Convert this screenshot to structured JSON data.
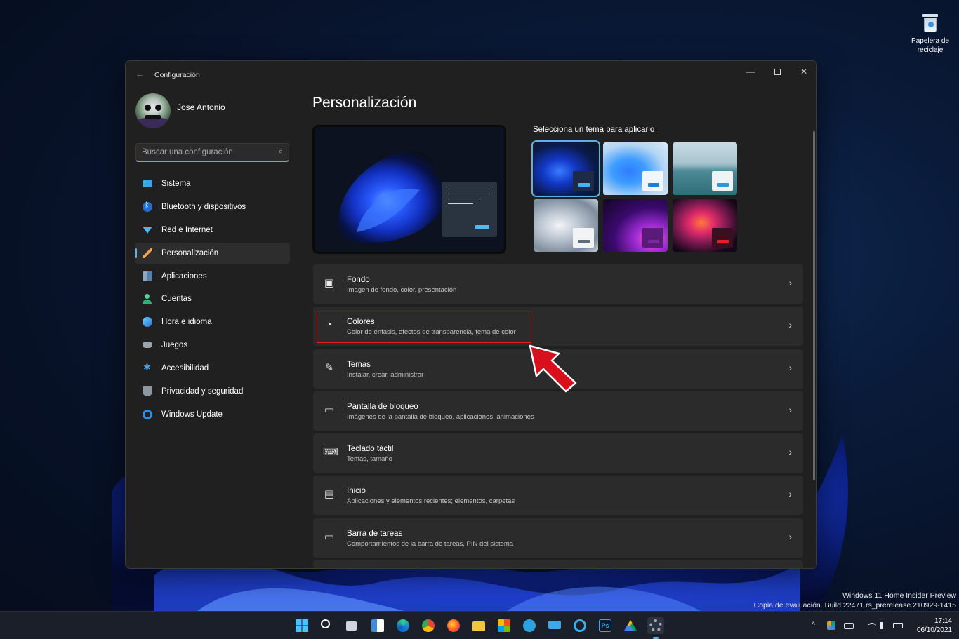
{
  "desktop": {
    "recycle_bin_label": "Papelera de reciclaje",
    "watermark_line1": "Windows 11 Home Insider Preview",
    "watermark_line2": "Copia de evaluación. Build 22471.rs_prerelease.210929-1415"
  },
  "window": {
    "back_glyph": "←",
    "title": "Configuración",
    "minimize_glyph": "—",
    "close_glyph": "✕"
  },
  "profile": {
    "name": "Jose Antonio"
  },
  "search": {
    "placeholder": "Buscar una configuración",
    "icon_glyph": "⌕"
  },
  "nav": {
    "items": [
      {
        "label": "Sistema",
        "icon": "monitor-icon"
      },
      {
        "label": "Bluetooth y dispositivos",
        "icon": "bluetooth-icon"
      },
      {
        "label": "Red e Internet",
        "icon": "wifi-icon"
      },
      {
        "label": "Personalización",
        "icon": "brush-icon",
        "active": true
      },
      {
        "label": "Aplicaciones",
        "icon": "apps-icon"
      },
      {
        "label": "Cuentas",
        "icon": "person-icon"
      },
      {
        "label": "Hora e idioma",
        "icon": "globe-clock-icon"
      },
      {
        "label": "Juegos",
        "icon": "gamepad-icon"
      },
      {
        "label": "Accesibilidad",
        "icon": "accessibility-icon"
      },
      {
        "label": "Privacidad y seguridad",
        "icon": "shield-icon"
      },
      {
        "label": "Windows Update",
        "icon": "update-icon"
      }
    ]
  },
  "main": {
    "title": "Personalización",
    "theme_label": "Selecciona un tema para aplicarlo",
    "cards": [
      {
        "title": "Fondo",
        "subtitle": "Imagen de fondo, color, presentación",
        "icon": "image-icon",
        "glyph": "▣"
      },
      {
        "title": "Colores",
        "subtitle": "Color de énfasis, efectos de transparencia, tema de color",
        "icon": "palette-icon",
        "glyph": "◔"
      },
      {
        "title": "Temas",
        "subtitle": "Instalar, crear, administrar",
        "icon": "brush-icon",
        "glyph": "✎"
      },
      {
        "title": "Pantalla de bloqueo",
        "subtitle": "Imágenes de la pantalla de bloqueo, aplicaciones, animaciones",
        "icon": "lock-screen-icon",
        "glyph": "▭"
      },
      {
        "title": "Teclado táctil",
        "subtitle": "Temas, tamaño",
        "icon": "keyboard-icon",
        "glyph": "⌨"
      },
      {
        "title": "Inicio",
        "subtitle": "Aplicaciones y elementos recientes; elementos, carpetas",
        "icon": "start-icon",
        "glyph": "▤"
      },
      {
        "title": "Barra de tareas",
        "subtitle": "Comportamientos de la barra de tareas, PIN del sistema",
        "icon": "taskbar-icon",
        "glyph": "▭"
      }
    ],
    "chevron_glyph": "›"
  },
  "taskbar": {
    "time": "17:14",
    "date": "06/10/2021",
    "ps_label": "Ps",
    "tray_chevron": "^"
  },
  "colors": {
    "accent": "#60b0e8",
    "highlight": "#e0202a"
  }
}
